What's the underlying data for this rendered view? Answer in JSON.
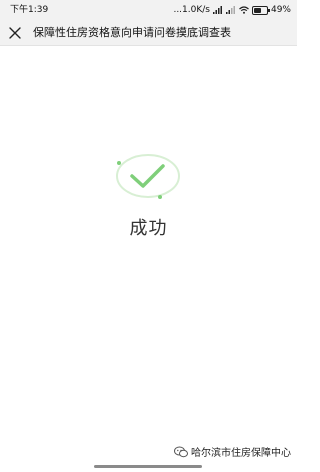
{
  "status_bar": {
    "time": "下午1:39",
    "network_speed": "...1.0K/s",
    "battery_text": "49%"
  },
  "title_bar": {
    "close_icon": "close-icon",
    "title": "保障性住房资格意向申请问卷摸底调查表"
  },
  "main": {
    "success_icon": "check-circle-icon",
    "success_text": "成功"
  },
  "watermark": {
    "icon": "wechat-icon",
    "text": "哈尔滨市住房保障中心"
  },
  "colors": {
    "check_green": "#7fcf7a",
    "ring_green": "#d8efd4",
    "status_bg": "#f2f2f2"
  }
}
